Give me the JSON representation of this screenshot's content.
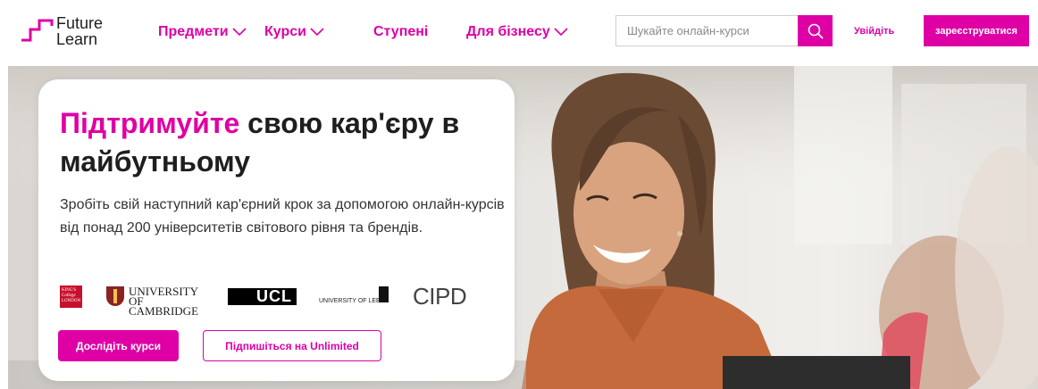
{
  "header": {
    "logo": {
      "line1": "Future",
      "line2": "Learn"
    },
    "nav": [
      {
        "label": "Предмети",
        "has_dropdown": true
      },
      {
        "label": "Курси",
        "has_dropdown": true
      },
      {
        "label": "Ступені",
        "has_dropdown": false
      },
      {
        "label": "Для бізнесу",
        "has_dropdown": true
      }
    ],
    "search": {
      "placeholder": "Шукайте онлайн-курси",
      "value": "",
      "icon": "search-icon"
    },
    "signin_label": "Увійдіть",
    "register_label": "зареєструватися"
  },
  "hero": {
    "headline_accent": "Підтримуйте",
    "headline_rest": " свою кар'єру в майбутньому",
    "lead": "Зробіть свій наступний кар'єрний крок за допомогою онлайн-курсів від понад 200 університетів світового рівня та брендів.",
    "partner_logos": {
      "kings": "KING'S College LONDON",
      "cambridge_line1": "UNIVERSITY OF",
      "cambridge_line2": "CAMBRIDGE",
      "ucl": "UCL",
      "leeds": "UNIVERSITY OF LEEDS",
      "cipd": "CIPD"
    },
    "primary_button": "Дослідіть курси",
    "secondary_button": "Підпишіться на Unlimited"
  },
  "colors": {
    "brand": "#de00a5",
    "text": "#1e1e1e"
  }
}
